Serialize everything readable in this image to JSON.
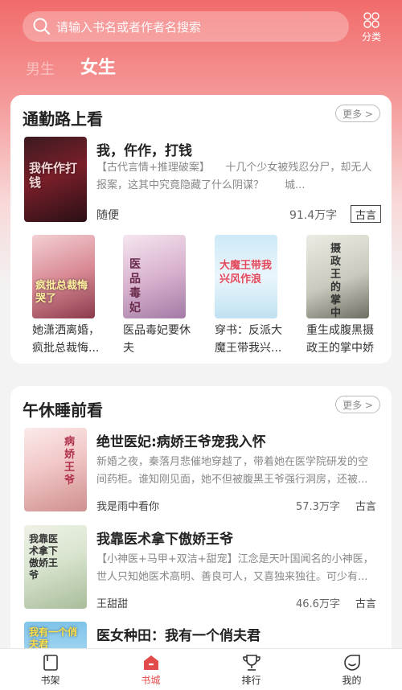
{
  "search": {
    "placeholder": "请输入书名或者作者名搜索"
  },
  "category": {
    "label": "分类"
  },
  "gender_tabs": [
    {
      "label": "男生",
      "active": false
    },
    {
      "label": "女生",
      "active": true
    }
  ],
  "section1": {
    "title": "通勤路上看",
    "more_label": "更多 >",
    "featured": {
      "title": "我，仵作，打钱",
      "cover_text": "我仵作打钱",
      "description": "【古代言情+推理破案】　　十几个少女被残忍分尸，却无人报案，这其中究竟隐藏了什么阴谋？　　城...",
      "author": "随便",
      "words": "91.4万字",
      "tag": "古言"
    },
    "books": [
      {
        "title": "她潇洒离婚，疯批总裁悔...",
        "cover_text": "疯批总裁悔哭了"
      },
      {
        "title": "医品毒妃要休夫",
        "cover_text": "医品毒妃"
      },
      {
        "title": "穿书：反派大魔王带我兴...",
        "cover_text": "大魔王带我兴风作浪"
      },
      {
        "title": "重生成腹黑摄政王的掌中娇",
        "cover_text": "摄政王的掌中娇"
      }
    ]
  },
  "section2": {
    "title": "午休睡前看",
    "more_label": "更多 >",
    "items": [
      {
        "title": "绝世医妃:病娇王爷宠我入怀",
        "cover_text": "病娇王爷",
        "description": "新婚之夜，秦落月悲催地穿越了，带着她在医学院研发的空间药柜。谁知刚见面，她不但被腹黑王爷强行洞房，还被...",
        "author": "我是雨中看你",
        "words": "57.3万字",
        "tag": "古言"
      },
      {
        "title": "我靠医术拿下傲娇王爷",
        "cover_text": "我靠医术拿下傲娇王爷",
        "description": "【小神医+马甲+双洁+甜宠】江念是天叶国闻名的小神医，世人只知她医术高明、善良可人，又喜独来独往。可少有...",
        "author": "王甜甜",
        "words": "46.6万字",
        "tag": "古言"
      },
      {
        "title": "医女种田：我有一个俏夫君",
        "cover_text": "我有一个俏夫君"
      }
    ]
  },
  "tabbar": [
    {
      "label": "书架",
      "icon": "bookshelf-icon",
      "active": false
    },
    {
      "label": "书城",
      "icon": "home-icon",
      "active": true
    },
    {
      "label": "排行",
      "icon": "trophy-icon",
      "active": false
    },
    {
      "label": "我的",
      "icon": "profile-icon",
      "active": false
    }
  ],
  "colors": {
    "accent": "#e14b4b",
    "header_top": "#f26b6b"
  }
}
